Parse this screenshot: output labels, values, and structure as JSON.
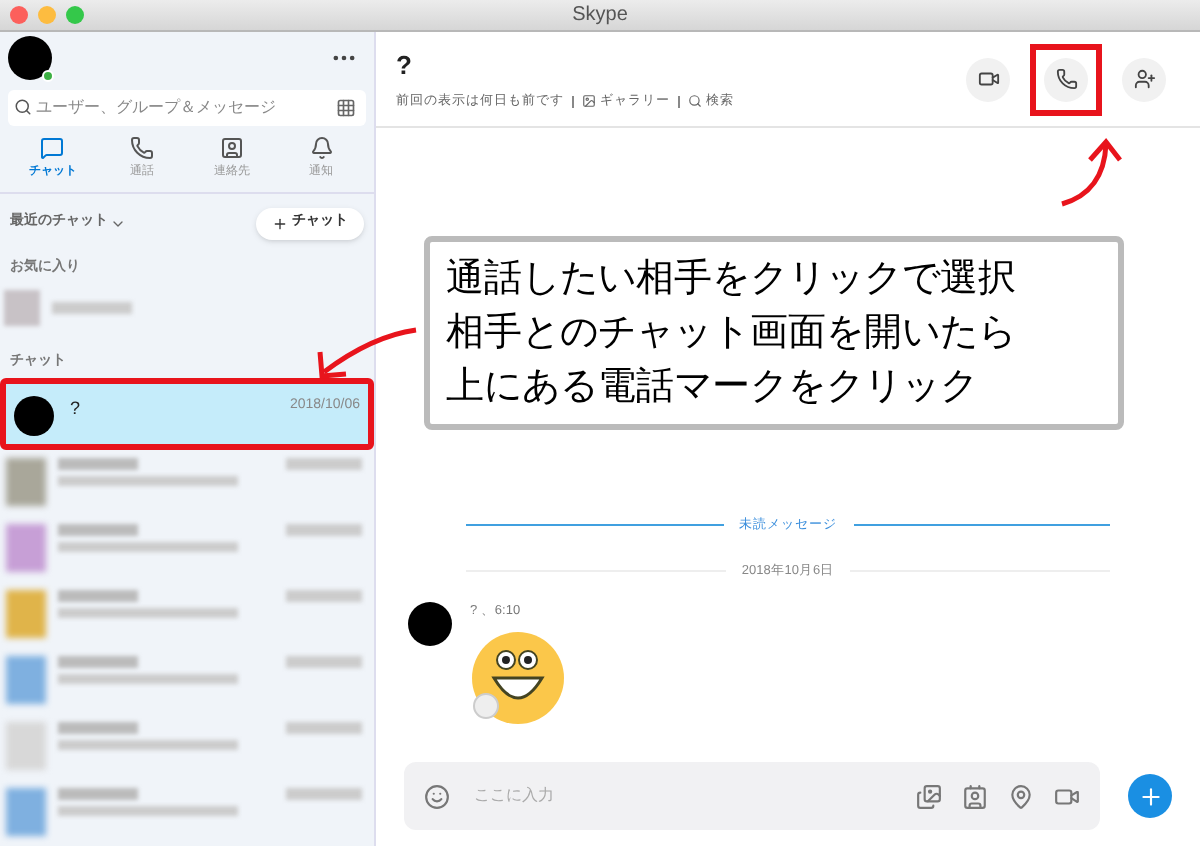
{
  "window": {
    "title": "Skype"
  },
  "sidebar": {
    "search": {
      "placeholder": "ユーザー、グループ＆メッセージ"
    },
    "nav": [
      {
        "kind": "chat",
        "label": "チャット",
        "selected": true
      },
      {
        "kind": "call",
        "label": "通話",
        "selected": false
      },
      {
        "kind": "contacts",
        "label": "連絡先",
        "selected": false
      },
      {
        "kind": "notify",
        "label": "通知",
        "selected": false
      }
    ],
    "recent_label": "最近のチャット",
    "new_chat_button": "チャット",
    "favorites_heading": "お気に入り",
    "chats_heading": "チャット",
    "chats": [
      {
        "name": "?",
        "date": "2018/10/06",
        "selected": true,
        "highlighted": true
      }
    ]
  },
  "conversation": {
    "name": "?",
    "last_seen": "前回の表示は何日も前です",
    "gallery": "ギャラリー",
    "search": "検索",
    "actions": [
      {
        "kind": "video",
        "highlighted": false
      },
      {
        "kind": "call",
        "highlighted": true
      },
      {
        "kind": "add_person",
        "highlighted": false
      }
    ],
    "unread_divider": "未読メッセージ",
    "date_divider": "2018年10月6日",
    "message": {
      "meta": "? 、6:10"
    },
    "composer": {
      "placeholder": "ここに入力"
    }
  },
  "callout": {
    "lines": [
      "通話したい相手をクリックで選択",
      "相手とのチャット画面を開いたら",
      "上にある電話マークをクリック"
    ]
  }
}
